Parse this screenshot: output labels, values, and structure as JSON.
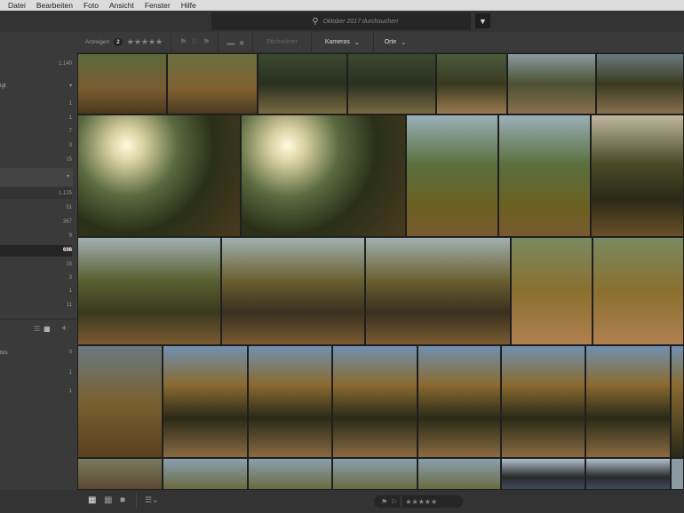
{
  "menu": [
    "Datei",
    "Bearbeiten",
    "Foto",
    "Ansicht",
    "Fenster",
    "Hilfe"
  ],
  "search": {
    "placeholder": "Oktober 2017 durchsuchen"
  },
  "filterbar": {
    "show_label": "Anzeigen",
    "rating_min": "2",
    "keywords": "Stichwörter",
    "cameras": "Kameras",
    "places": "Orte"
  },
  "sidebar": {
    "total": "1.140",
    "group1_label": "igt",
    "group1_counts": [
      "1",
      "1",
      "7",
      "3",
      "15"
    ],
    "group2_counts": [
      "1.125",
      "51",
      "367",
      "9",
      "698",
      "15",
      "3",
      "1",
      "11"
    ],
    "albums_label": "tos",
    "albums_counts": [
      "0",
      "1",
      "1"
    ]
  }
}
